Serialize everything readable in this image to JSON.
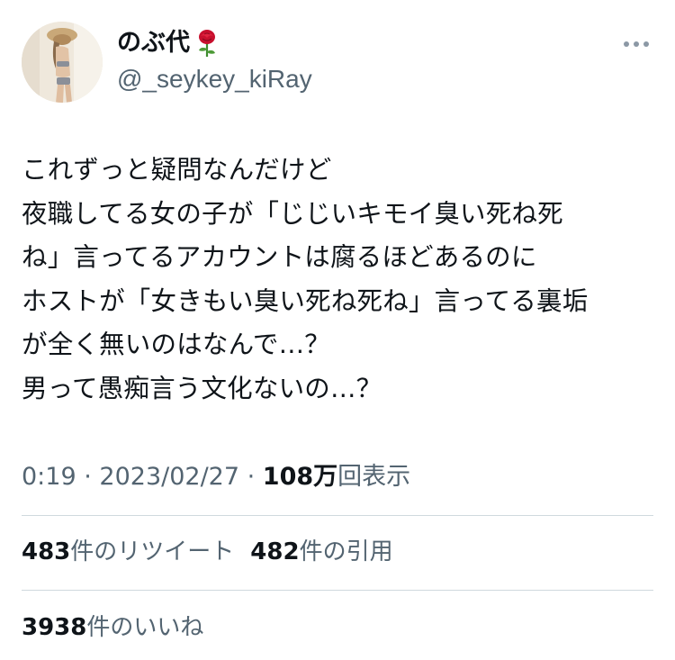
{
  "author": {
    "display_name": "のぶ代",
    "handle": "@_seykey_kiRay",
    "name_emoji": "rose-icon"
  },
  "tweet": {
    "text": "これずっと疑問なんだけど\n夜職してる女の子が「じじいキモイ臭い死ね死\nね」言ってるアカウントは腐るほどあるのに\nホストが「女きもい臭い死ね死ね」言ってる裏垢\nが全く無いのはなんで…？\n男って愚痴言う文化ないの…？"
  },
  "meta": {
    "time": "0:19",
    "separator": "·",
    "date": "2023/02/27",
    "views_count": "108万",
    "views_label": "回表示"
  },
  "stats": {
    "retweets_count": "483",
    "retweets_label": "件のリツイート",
    "quotes_count": "482",
    "quotes_label": "件の引用",
    "likes_count": "3938",
    "likes_label": "件のいいね"
  },
  "colors": {
    "text_primary": "#0f1419",
    "text_secondary": "#536471",
    "divider": "#cfd9de"
  }
}
